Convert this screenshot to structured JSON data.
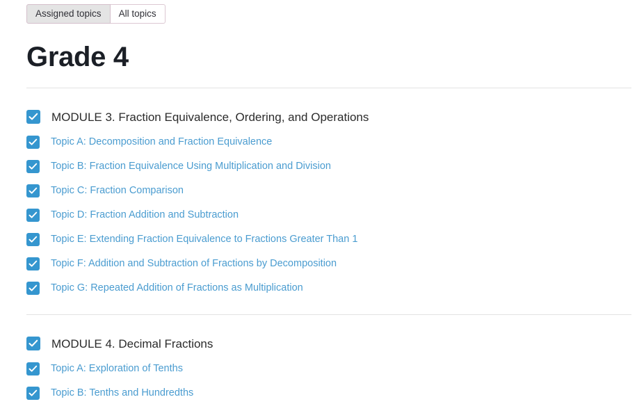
{
  "tabs": [
    {
      "label": "Assigned topics",
      "active": true
    },
    {
      "label": "All topics",
      "active": false
    }
  ],
  "page": {
    "title": "Grade 4"
  },
  "colors": {
    "accent_blue": "#3596cf",
    "link_blue": "#4a9cd0",
    "heading": "#1b1f26",
    "module_text": "#2b2b2b",
    "divider": "#e2e2e2",
    "tab_active_bg": "#e4e4e4",
    "tab_border": "#dcc8d2"
  },
  "modules": [
    {
      "title": "MODULE 3. Fraction Equivalence, Ordering, and Operations",
      "checked": true,
      "checkbox_icon": "check-icon",
      "topics": [
        {
          "label": "Topic A: Decomposition and Fraction Equivalence",
          "checked": true
        },
        {
          "label": "Topic B: Fraction Equivalence Using Multiplication and Division",
          "checked": true
        },
        {
          "label": "Topic C: Fraction Comparison",
          "checked": true
        },
        {
          "label": "Topic D: Fraction Addition and Subtraction",
          "checked": true
        },
        {
          "label": "Topic E: Extending Fraction Equivalence to Fractions Greater Than 1",
          "checked": true
        },
        {
          "label": "Topic F: Addition and Subtraction of Fractions by Decomposition",
          "checked": true
        },
        {
          "label": "Topic G: Repeated Addition of Fractions as Multiplication",
          "checked": true
        }
      ]
    },
    {
      "title": "MODULE 4. Decimal Fractions",
      "checked": true,
      "checkbox_icon": "check-icon",
      "topics": [
        {
          "label": "Topic A: Exploration of Tenths",
          "checked": true
        },
        {
          "label": "Topic B: Tenths and Hundredths",
          "checked": true
        }
      ]
    }
  ]
}
